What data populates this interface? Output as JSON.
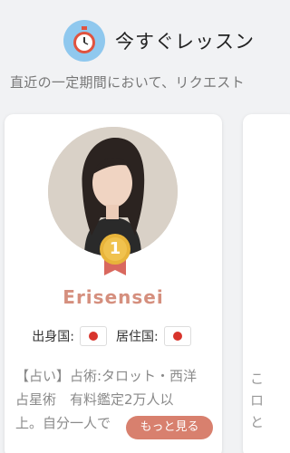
{
  "header": {
    "icon": "stopwatch-icon",
    "title": "今すぐレッスン"
  },
  "subtitle": "直近の一定期間において、リクエスト",
  "card": {
    "rank": "1",
    "name": "Erisensei",
    "origin_label": "出身国:",
    "residence_label": "居住国:",
    "origin_flag": "japan-flag-icon",
    "residence_flag": "japan-flag-icon",
    "description_lines": [
      "【占い】占術:タロット・西洋",
      "占星術　有料鑑定2万人以",
      "上。自分一人で"
    ],
    "more_button": "もっと見る"
  },
  "next_card": {
    "peek_lines": [
      "こ",
      "ロ",
      "と"
    ]
  },
  "colors": {
    "accent": "#d8806e",
    "name": "#d58f7e",
    "timer_bg": "#8fc8ee",
    "medal_gold": "#e8b43a",
    "ribbon": "#d9685e"
  }
}
